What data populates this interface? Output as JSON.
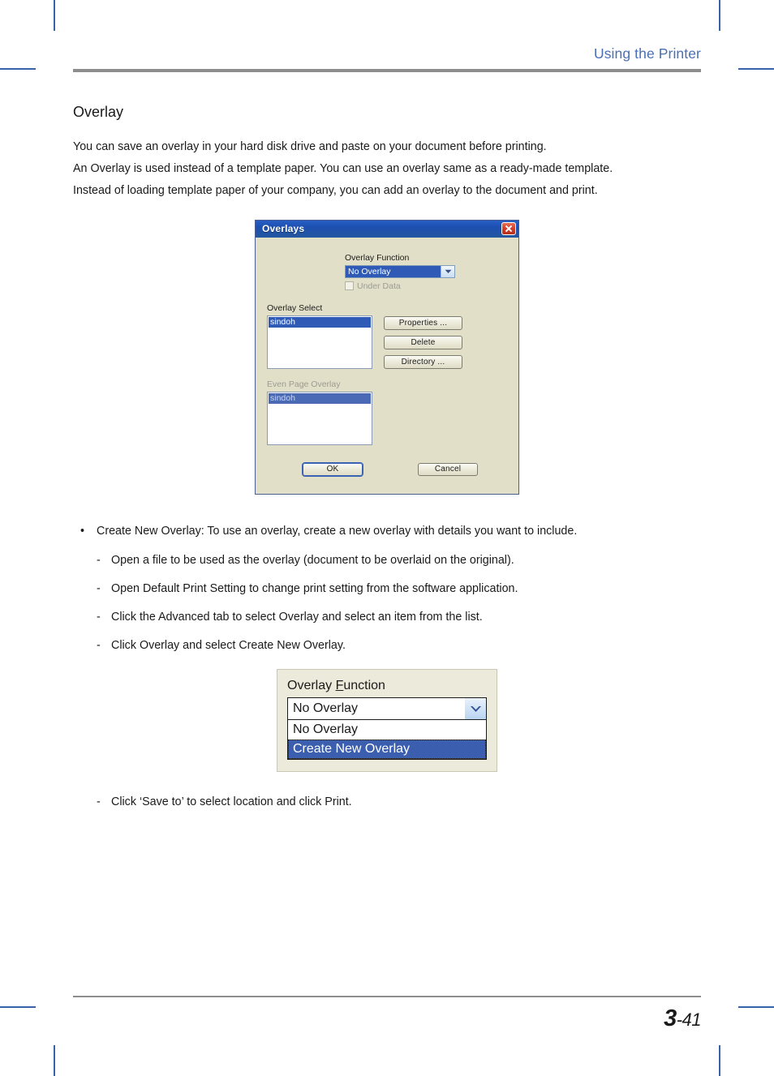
{
  "header": {
    "title": "Using the Printer"
  },
  "section": {
    "title": "Overlay",
    "paragraphs": [
      "You can save an overlay in your hard disk drive and paste on your document before printing.",
      "An Overlay is used instead of a template paper. You can use an overlay same as a ready-made template.",
      "Instead of loading template paper of your company, you can add an overlay to the document and print."
    ]
  },
  "dialog": {
    "title": "Overlays",
    "close_icon": "close-icon",
    "overlay_function": {
      "label": "Overlay Function",
      "value": "No Overlay"
    },
    "under_data": {
      "label": "Under Data",
      "checked": false
    },
    "overlay_select": {
      "label": "Overlay Select",
      "items": [
        "sindoh"
      ],
      "selected": "sindoh"
    },
    "buttons": {
      "properties": "Properties ...",
      "delete": "Delete",
      "directory": "Directory ..."
    },
    "even_page_overlay": {
      "label": "Even Page Overlay",
      "items": [
        "sindoh"
      ],
      "selected": "sindoh"
    },
    "footer_buttons": {
      "ok": "OK",
      "cancel": "Cancel"
    }
  },
  "bullets": {
    "main": "Create New Overlay: To use an overlay, create a new overlay with details you want to include.",
    "subitems": [
      "Open a file to be used as the overlay (document to be overlaid on the original).",
      "Open Default Print Setting to change print setting from the software application.",
      "Click the Advanced tab to select Overlay and select an item from the list.",
      "Click Overlay and select Create New Overlay."
    ],
    "tail": "Click ‘Save to’ to select location and click Print.",
    "bullet_glyph": "•",
    "dash_glyph": "-"
  },
  "figure_combo": {
    "label_pre": "Overlay ",
    "label_accel": "F",
    "label_post": "unction",
    "value": "No Overlay",
    "options": [
      "No Overlay",
      "Create New Overlay"
    ],
    "selected": "Create New Overlay"
  },
  "footer": {
    "page_major": "3",
    "page_minor": "-41"
  },
  "colors": {
    "header_blue": "#4a6fb5",
    "rule_gray": "#8d8d8d",
    "crop_blue": "#3a62ab",
    "dialog_bg": "#e2dfc9",
    "titlebar_blue": "#1d4fb0",
    "selection_blue": "#2f5bb7",
    "close_red": "#d8402a"
  }
}
